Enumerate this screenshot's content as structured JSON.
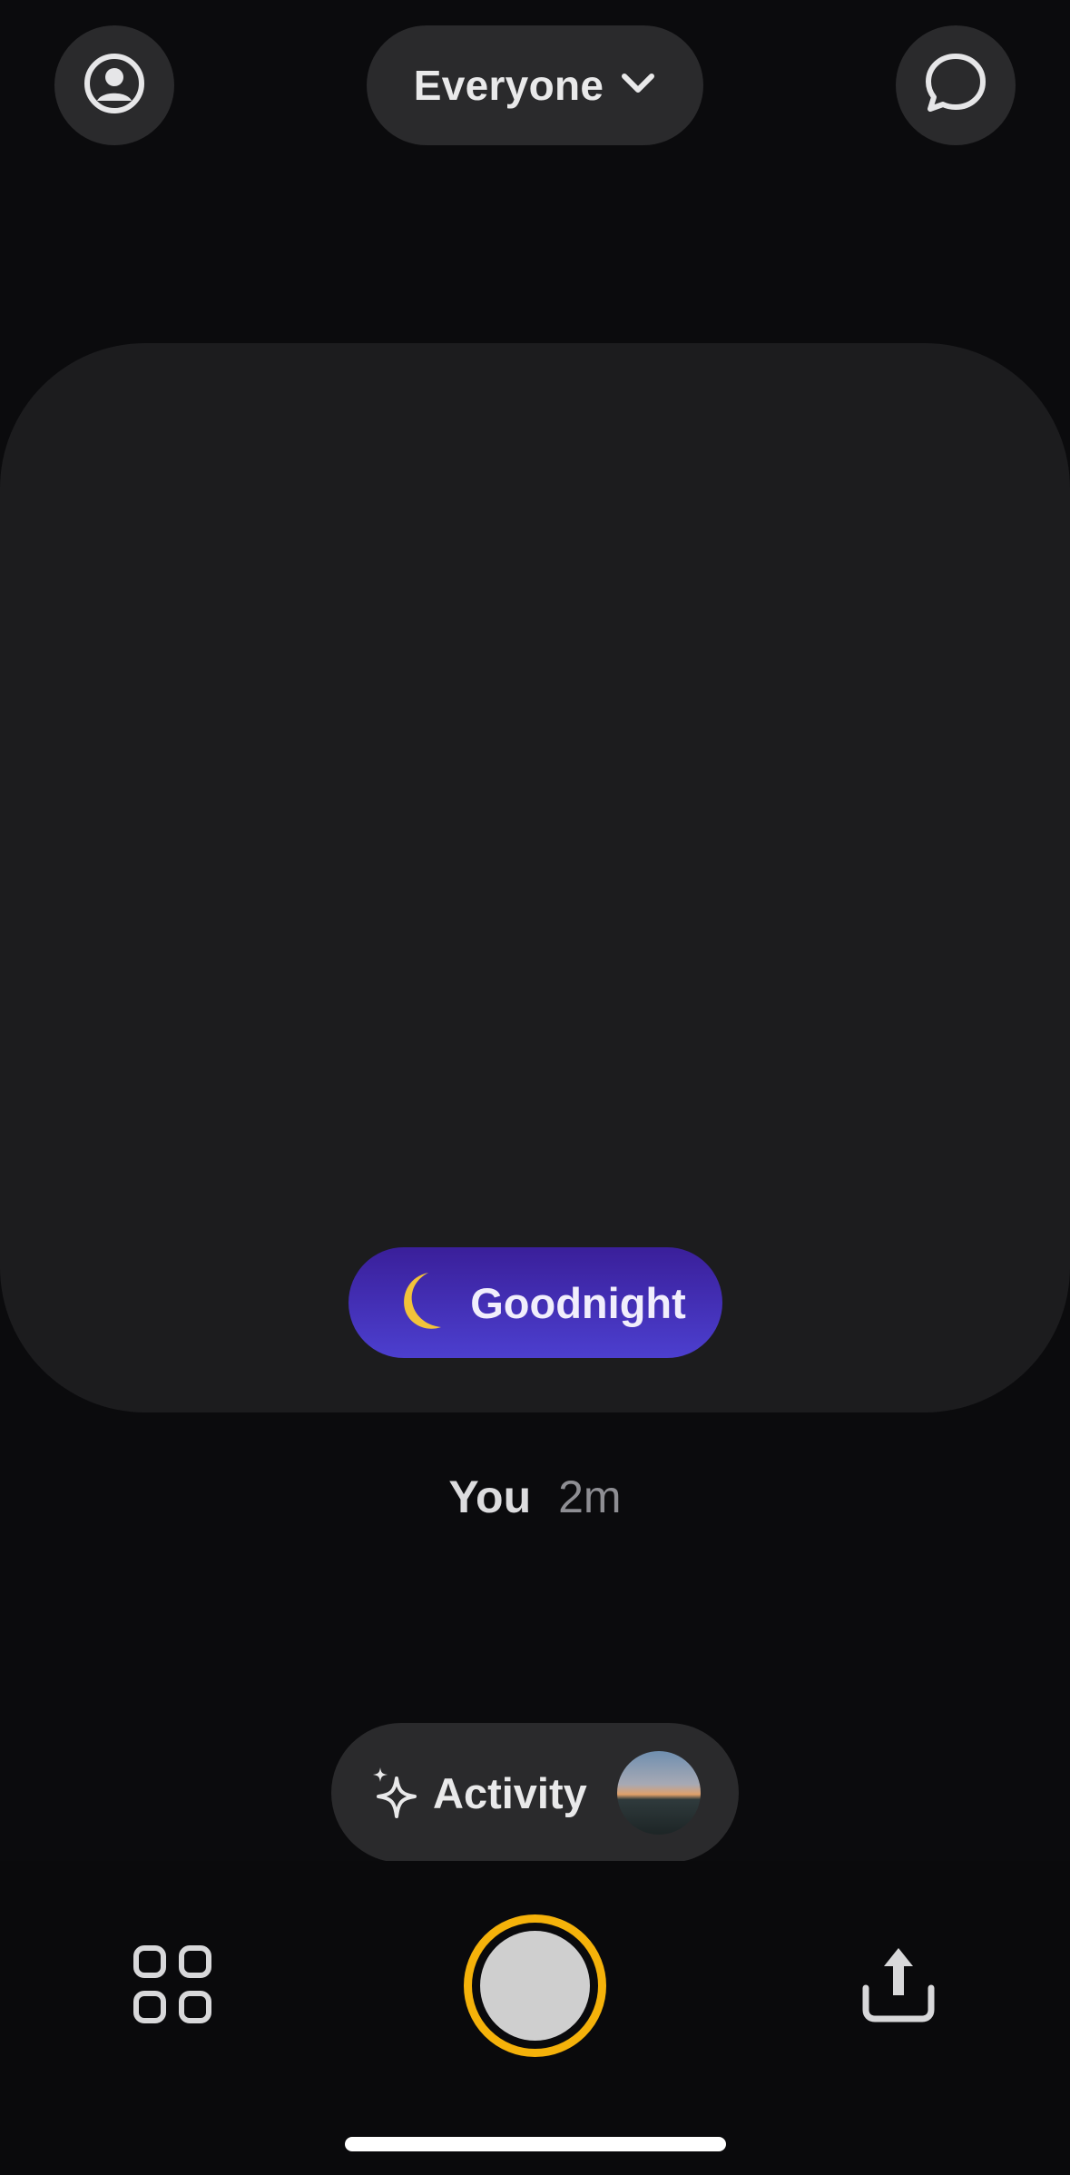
{
  "top_bar": {
    "profile_icon": "person-circle-icon",
    "audience_label": "Everyone",
    "audience_icon": "chevron-down-icon",
    "chat_icon": "chat-bubble-icon"
  },
  "post": {
    "mood_emoji": "🌙",
    "mood_label": "Goodnight",
    "author": "You",
    "time_ago": "2m"
  },
  "activity": {
    "icon": "sparkles-icon",
    "label": "Activity"
  },
  "bottom_bar": {
    "grid_icon": "grid-icon",
    "upload_icon": "share-upload-icon"
  },
  "colors": {
    "background": "#0b0b0d",
    "card": "#1c1c1e",
    "pill": "#2a2a2c",
    "shutter_ring": "#f5b20a",
    "mood_gradient_top": "#3a1f9a",
    "mood_gradient_bottom": "#4c3fcf"
  }
}
